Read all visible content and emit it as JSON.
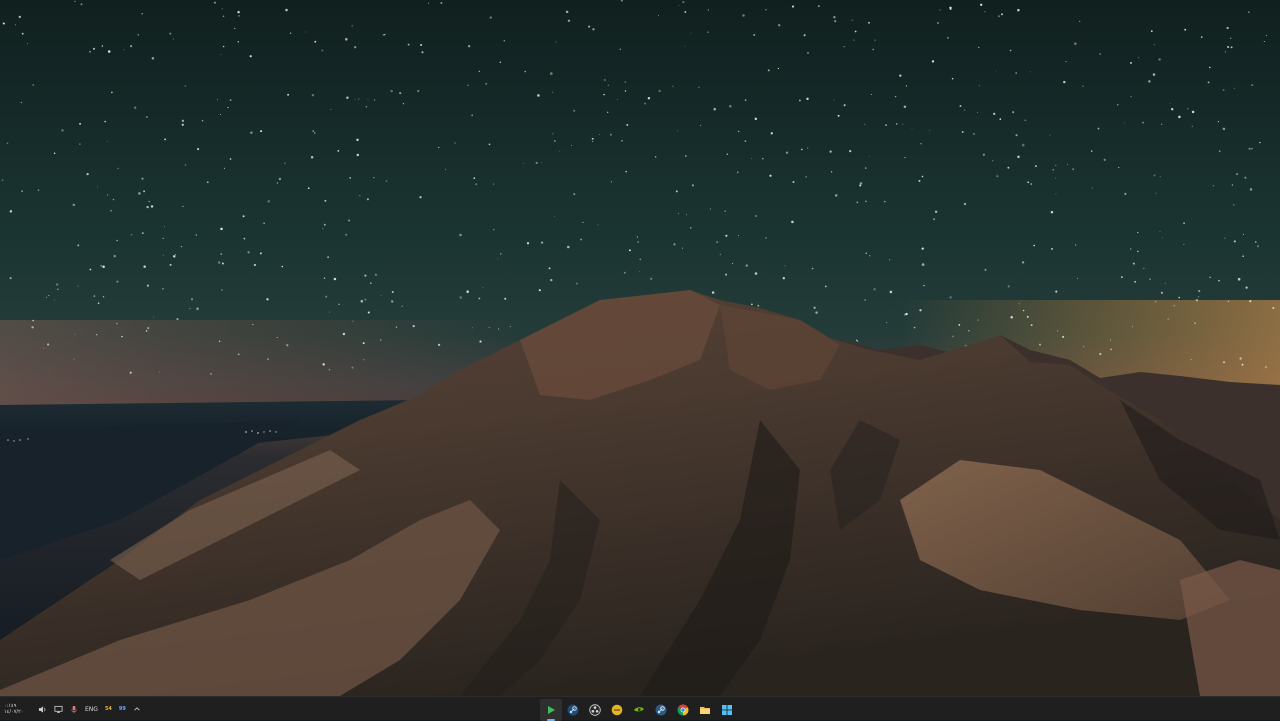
{
  "desktop": {
    "wallpaper": "starry-night-mountain-wallpaper"
  },
  "taskbar": {
    "clock": {
      "time": "٠:١٤٩",
      "date": "١٤/٠٧/٢٠"
    },
    "tray": {
      "language": "ENG",
      "badge_one": "54",
      "badge_two": "99"
    },
    "apps": [
      {
        "name": "media-player-icon",
        "active": true
      },
      {
        "name": "steam-icon"
      },
      {
        "name": "obs-icon"
      },
      {
        "name": "yellow-app-icon"
      },
      {
        "name": "nvidia-icon"
      },
      {
        "name": "steam-icon-2"
      },
      {
        "name": "chrome-icon"
      },
      {
        "name": "file-explorer-icon"
      },
      {
        "name": "windows-app-icon"
      }
    ],
    "colors": {
      "background": "#1f1f1f",
      "accent": "#5fb3ff",
      "badge_one": "#e8b23a",
      "badge_two": "#6aa8ff"
    }
  }
}
